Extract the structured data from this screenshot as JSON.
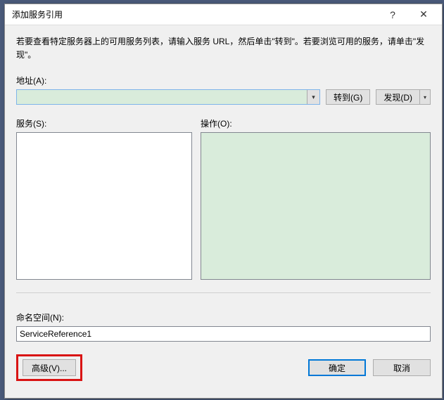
{
  "window": {
    "title": "添加服务引用",
    "help": "?",
    "close": "✕"
  },
  "description": "若要查看特定服务器上的可用服务列表，请输入服务 URL，然后单击\"转到\"。若要浏览可用的服务，请单击\"发现\"。",
  "address": {
    "label": "地址(A):",
    "value": ""
  },
  "buttons": {
    "go": "转到(G)",
    "discover": "发现(D)",
    "advanced": "高级(V)...",
    "ok": "确定",
    "cancel": "取消"
  },
  "lists": {
    "services_label": "服务(S):",
    "operations_label": "操作(O):"
  },
  "namespace": {
    "label": "命名空间(N):",
    "value": "ServiceReference1"
  }
}
